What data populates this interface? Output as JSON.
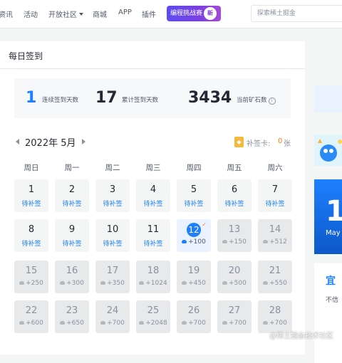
{
  "nav": {
    "items": [
      "资讯",
      "活动",
      "开放社区",
      "商城",
      "APP",
      "插件"
    ],
    "challenge_label": "编程挑战赛",
    "challenge_badge": "新",
    "search_placeholder": "探索稀土掘金"
  },
  "page": {
    "title": "每日签到"
  },
  "stats": [
    {
      "value": "1",
      "label": "连续签到天数",
      "color": "#1e80ff"
    },
    {
      "value": "17",
      "label": "累计签到天数",
      "color": "#252933"
    },
    {
      "value": "3434",
      "label": "当前矿石数",
      "color": "#252933"
    }
  ],
  "calendar": {
    "month": "2022年 5月",
    "card_label": "补签卡:",
    "card_count": "0",
    "card_unit": "张",
    "weekdays": [
      "周日",
      "周一",
      "周二",
      "周三",
      "周四",
      "周五",
      "周六"
    ],
    "cells": [
      {
        "day": "1",
        "sub": "待补签",
        "kind": "missed"
      },
      {
        "day": "2",
        "sub": "待补签",
        "kind": "missed"
      },
      {
        "day": "3",
        "sub": "待补签",
        "kind": "missed"
      },
      {
        "day": "4",
        "sub": "待补签",
        "kind": "missed"
      },
      {
        "day": "5",
        "sub": "待补签",
        "kind": "missed"
      },
      {
        "day": "6",
        "sub": "待补签",
        "kind": "missed"
      },
      {
        "day": "7",
        "sub": "待补签",
        "kind": "missed"
      },
      {
        "day": "8",
        "sub": "待补签",
        "kind": "missed"
      },
      {
        "day": "9",
        "sub": "待补签",
        "kind": "missed"
      },
      {
        "day": "10",
        "sub": "待补签",
        "kind": "missed"
      },
      {
        "day": "11",
        "sub": "待补签",
        "kind": "missed"
      },
      {
        "day": "12",
        "sub": "+100",
        "kind": "today"
      },
      {
        "day": "13",
        "sub": "+150",
        "kind": "future"
      },
      {
        "day": "14",
        "sub": "+512",
        "kind": "future"
      },
      {
        "day": "15",
        "sub": "+250",
        "kind": "future"
      },
      {
        "day": "16",
        "sub": "+300",
        "kind": "future"
      },
      {
        "day": "17",
        "sub": "+350",
        "kind": "future"
      },
      {
        "day": "18",
        "sub": "+1024",
        "kind": "future"
      },
      {
        "day": "19",
        "sub": "+450",
        "kind": "future"
      },
      {
        "day": "20",
        "sub": "+500",
        "kind": "future"
      },
      {
        "day": "21",
        "sub": "+550",
        "kind": "future"
      },
      {
        "day": "22",
        "sub": "+600",
        "kind": "future"
      },
      {
        "day": "23",
        "sub": "+650",
        "kind": "future"
      },
      {
        "day": "24",
        "sub": "+700",
        "kind": "future"
      },
      {
        "day": "25",
        "sub": "+2048",
        "kind": "future"
      },
      {
        "day": "26",
        "sub": "+700",
        "kind": "future"
      },
      {
        "day": "27",
        "sub": "+700",
        "kind": "future"
      },
      {
        "day": "28",
        "sub": "+700",
        "kind": "future"
      }
    ]
  },
  "sidebar": {
    "day_big": "1",
    "month_short": "May",
    "promo_title": "宜",
    "promo_text": "不信"
  },
  "watermark": "@稀土掘金技术社区",
  "colors": {
    "accent": "#1e80ff",
    "orange": "#ff7a1a"
  }
}
